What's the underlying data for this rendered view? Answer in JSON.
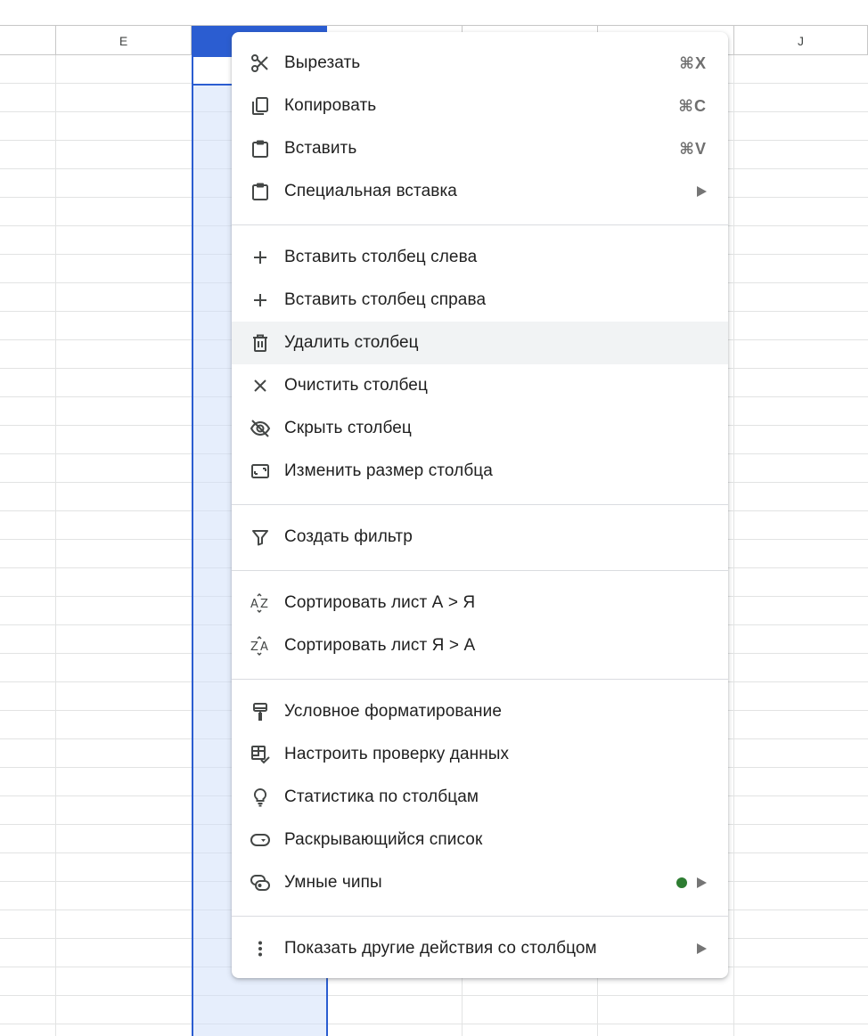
{
  "sheet": {
    "columns": [
      {
        "label": "",
        "selected": false
      },
      {
        "label": "E",
        "selected": false
      },
      {
        "label": "",
        "selected": true
      },
      {
        "label": "",
        "selected": false
      },
      {
        "label": "",
        "selected": false
      },
      {
        "label": "",
        "selected": false
      },
      {
        "label": "J",
        "selected": false
      }
    ]
  },
  "context_menu": {
    "groups": [
      [
        {
          "label": "Вырезать",
          "icon": "scissors-icon",
          "shortcut": "⌘X"
        },
        {
          "label": "Копировать",
          "icon": "copy-icon",
          "shortcut": "⌘C"
        },
        {
          "label": "Вставить",
          "icon": "clipboard-icon",
          "shortcut": "⌘V"
        },
        {
          "label": "Специальная вставка",
          "icon": "clipboard-icon",
          "submenu": true
        }
      ],
      [
        {
          "label": "Вставить столбец слева",
          "icon": "plus-icon"
        },
        {
          "label": "Вставить столбец справа",
          "icon": "plus-icon"
        },
        {
          "label": "Удалить столбец",
          "icon": "trash-icon",
          "hovered": true
        },
        {
          "label": "Очистить столбец",
          "icon": "close-icon"
        },
        {
          "label": "Скрыть столбец",
          "icon": "eye-off-icon"
        },
        {
          "label": "Изменить размер столбца",
          "icon": "resize-icon"
        }
      ],
      [
        {
          "label": "Создать фильтр",
          "icon": "filter-icon"
        }
      ],
      [
        {
          "label": "Сортировать лист А > Я",
          "icon": "sort-az-icon"
        },
        {
          "label": "Сортировать лист Я > А",
          "icon": "sort-za-icon"
        }
      ],
      [
        {
          "label": "Условное форматирование",
          "icon": "paint-roller-icon"
        },
        {
          "label": "Настроить проверку данных",
          "icon": "data-validation-icon"
        },
        {
          "label": "Статистика по столбцам",
          "icon": "lightbulb-icon"
        },
        {
          "label": "Раскрывающийся список",
          "icon": "dropdown-chip-icon"
        },
        {
          "label": "Умные чипы",
          "icon": "smart-chip-icon",
          "submenu": true,
          "badge_dot": true
        }
      ],
      [
        {
          "label": "Показать другие действия со столбцом",
          "icon": "more-vert-icon",
          "submenu": true
        }
      ]
    ]
  },
  "colors": {
    "selection": "#2b5dd1",
    "hover": "#f1f3f4",
    "badge": "#2e7d32"
  }
}
